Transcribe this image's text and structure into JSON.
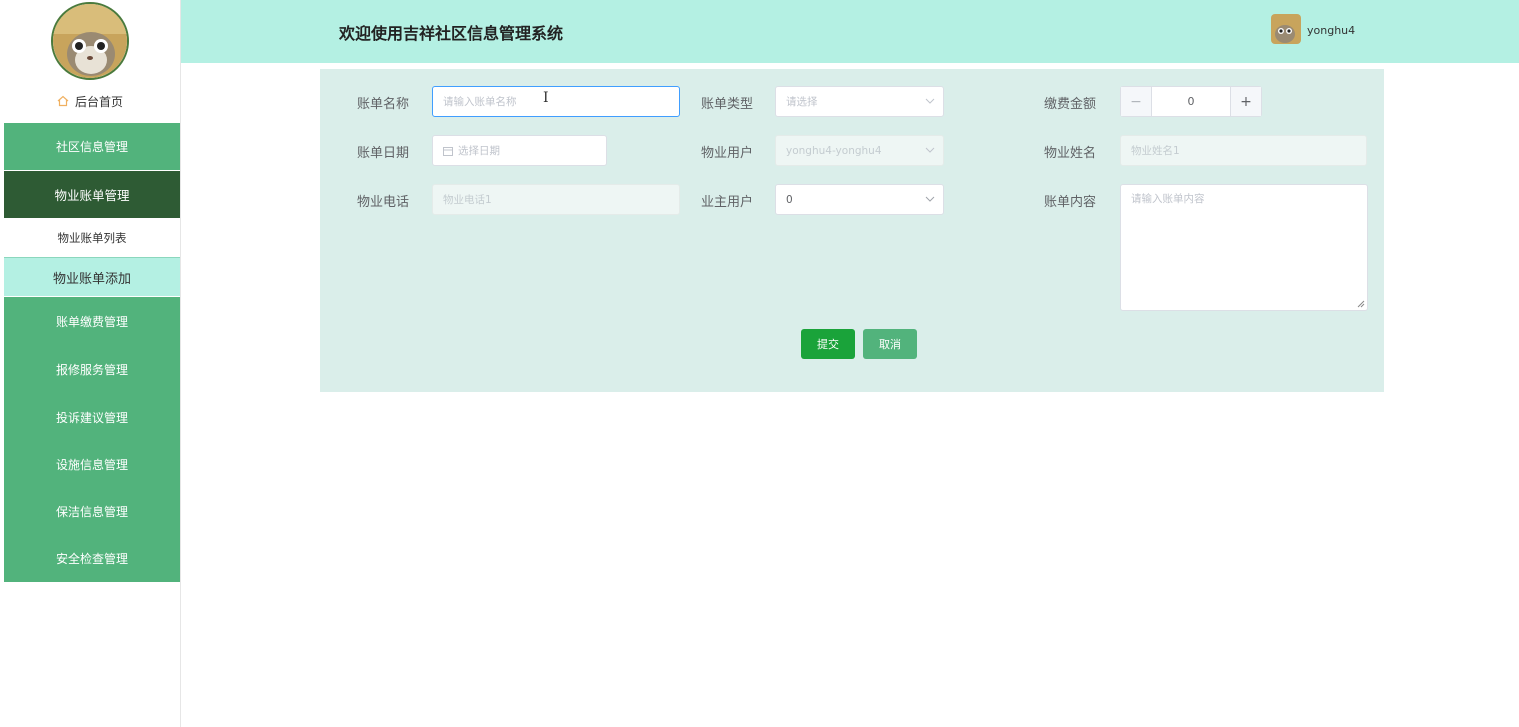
{
  "sidebar": {
    "home_label": "后台首页",
    "menu": [
      {
        "label": "社区信息管理"
      },
      {
        "label": "物业账单管理"
      },
      {
        "label": "账单缴费管理"
      },
      {
        "label": "报修服务管理"
      },
      {
        "label": "投诉建议管理"
      },
      {
        "label": "设施信息管理"
      },
      {
        "label": "保洁信息管理"
      },
      {
        "label": "安全检查管理"
      }
    ],
    "submenu": [
      {
        "label": "物业账单列表"
      },
      {
        "label": "物业账单添加"
      }
    ]
  },
  "header": {
    "title": "欢迎使用吉祥社区信息管理系统",
    "username": "yonghu4"
  },
  "form": {
    "bill_name": {
      "label": "账单名称",
      "placeholder": "请输入账单名称"
    },
    "bill_type": {
      "label": "账单类型",
      "placeholder": "请选择"
    },
    "amount": {
      "label": "缴费金额",
      "value": "0",
      "minus": "−",
      "plus": "+"
    },
    "bill_date": {
      "label": "账单日期",
      "placeholder": "选择日期"
    },
    "property_user": {
      "label": "物业用户",
      "value": "yonghu4-yonghu4"
    },
    "property_name": {
      "label": "物业姓名",
      "value": "物业姓名1"
    },
    "property_phone": {
      "label": "物业电话",
      "value": "物业电话1"
    },
    "owner_user": {
      "label": "业主用户",
      "value": "0"
    },
    "bill_content": {
      "label": "账单内容",
      "placeholder": "请输入账单内容"
    },
    "submit_label": "提交",
    "cancel_label": "取消"
  },
  "colors": {
    "header_bg": "#b4f0e3",
    "menu_bg": "#52b37c",
    "menu_active_bg": "#2e5b34",
    "panel_bg": "#daeeea",
    "submit_bg": "#1aa33a"
  }
}
